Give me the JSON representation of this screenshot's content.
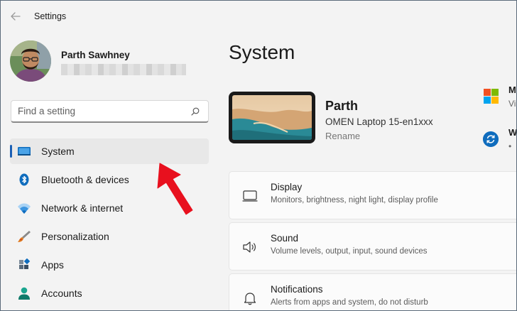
{
  "window": {
    "title": "Settings"
  },
  "profile": {
    "name": "Parth Sawhney"
  },
  "search": {
    "placeholder": "Find a setting"
  },
  "nav": [
    {
      "label": "System",
      "icon": "system-icon",
      "selected": true
    },
    {
      "label": "Bluetooth & devices",
      "icon": "bluetooth-icon"
    },
    {
      "label": "Network & internet",
      "icon": "wifi-icon"
    },
    {
      "label": "Personalization",
      "icon": "brush-icon"
    },
    {
      "label": "Apps",
      "icon": "apps-icon"
    },
    {
      "label": "Accounts",
      "icon": "person-icon"
    }
  ],
  "main": {
    "title": "System",
    "device": {
      "name": "Parth",
      "model": "OMEN Laptop 15-en1xxx",
      "rename": "Rename"
    },
    "status": [
      {
        "label": "M",
        "sub": "Vi",
        "icon": "microsoft-365-icon"
      },
      {
        "label": "W",
        "sub": "•",
        "icon": "windows-update-icon"
      }
    ],
    "cards": [
      {
        "title": "Display",
        "subtitle": "Monitors, brightness, night light, display profile",
        "icon": "display-icon"
      },
      {
        "title": "Sound",
        "subtitle": "Volume levels, output, input, sound devices",
        "icon": "speaker-icon"
      },
      {
        "title": "Notifications",
        "subtitle": "Alerts from apps and system, do not disturb",
        "icon": "bell-icon"
      }
    ]
  },
  "colors": {
    "accent": "#1a5fb4",
    "annotation_arrow": "#e8101e"
  }
}
